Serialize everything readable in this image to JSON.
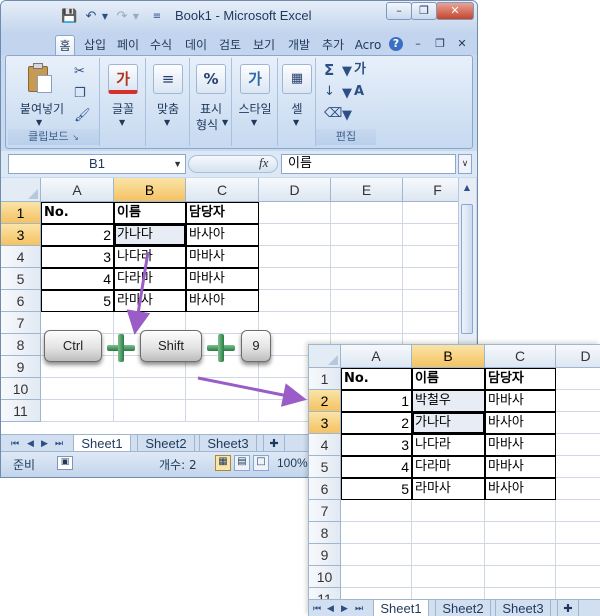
{
  "window": {
    "title": "Book1 - Microsoft Excel",
    "minimize": "–",
    "restore": "❐",
    "close": "✕"
  },
  "ribbon": {
    "tabs": [
      "홈",
      "삽입",
      "페이",
      "수식",
      "데이",
      "검토",
      "보기",
      "개발",
      "추가",
      "Acro"
    ],
    "active_tab": "홈",
    "clipboard": {
      "paste_label": "붙여넣기",
      "group_label": "클립보드"
    },
    "font": {
      "label": "글꼴",
      "icon_text": "가"
    },
    "align": {
      "label": "맞춤"
    },
    "number": {
      "label_line1": "표시",
      "label_line2": "형식",
      "icon_text": "%"
    },
    "style": {
      "label": "스타일",
      "icon_text": "가"
    },
    "cells": {
      "label": "셀"
    },
    "editing": {
      "group_label": "편집",
      "sum": "Σ",
      "sort": "가",
      "find": "A"
    }
  },
  "formula_bar": {
    "name_box": "B1",
    "fx": "fx",
    "value": "이름"
  },
  "sheet1": {
    "columns": [
      "A",
      "B",
      "C",
      "D",
      "E",
      "F"
    ],
    "selected_column": "B",
    "rows": [
      {
        "num": "1",
        "a": "No.",
        "b": "이름",
        "c": "담당자"
      },
      {
        "num": "3",
        "a": "2",
        "b": "가나다",
        "c": "바사아"
      },
      {
        "num": "4",
        "a": "3",
        "b": "나다라",
        "c": "마바사"
      },
      {
        "num": "5",
        "a": "4",
        "b": "다라마",
        "c": "마바사"
      },
      {
        "num": "6",
        "a": "5",
        "b": "라마사",
        "c": "바사아"
      },
      {
        "num": "7",
        "a": "",
        "b": "",
        "c": ""
      },
      {
        "num": "8",
        "a": "",
        "b": "",
        "c": ""
      },
      {
        "num": "9",
        "a": "",
        "b": "",
        "c": ""
      },
      {
        "num": "10",
        "a": "",
        "b": "",
        "c": ""
      },
      {
        "num": "11",
        "a": "",
        "b": "",
        "c": ""
      }
    ],
    "sheet_tabs": [
      "Sheet1",
      "Sheet2",
      "Sheet3"
    ]
  },
  "status": {
    "ready": "준비",
    "count": "개수: 2",
    "zoom": "100%"
  },
  "shortcut_keys": [
    "Ctrl",
    "Shift",
    "9"
  ],
  "sheet_after": {
    "columns": [
      "A",
      "B",
      "C",
      "D"
    ],
    "rows": [
      {
        "num": "1",
        "a": "No.",
        "b": "이름",
        "c": "담당자"
      },
      {
        "num": "2",
        "a": "1",
        "b": "박철우",
        "c": "마바사"
      },
      {
        "num": "3",
        "a": "2",
        "b": "가나다",
        "c": "바사아"
      },
      {
        "num": "4",
        "a": "3",
        "b": "나다라",
        "c": "마바사"
      },
      {
        "num": "5",
        "a": "4",
        "b": "다라마",
        "c": "마바사"
      },
      {
        "num": "6",
        "a": "5",
        "b": "라마사",
        "c": "바사아"
      },
      {
        "num": "7",
        "a": "",
        "b": "",
        "c": ""
      },
      {
        "num": "8",
        "a": "",
        "b": "",
        "c": ""
      },
      {
        "num": "9",
        "a": "",
        "b": "",
        "c": ""
      },
      {
        "num": "10",
        "a": "",
        "b": "",
        "c": ""
      },
      {
        "num": "11",
        "a": "",
        "b": "",
        "c": ""
      }
    ],
    "sheet_tabs": [
      "Sheet1",
      "Sheet2",
      "Sheet3"
    ]
  },
  "colors": {
    "arrow": "#9a5cc6",
    "selected_header": "#f4c262",
    "ribbon": "#d3e2f4"
  }
}
